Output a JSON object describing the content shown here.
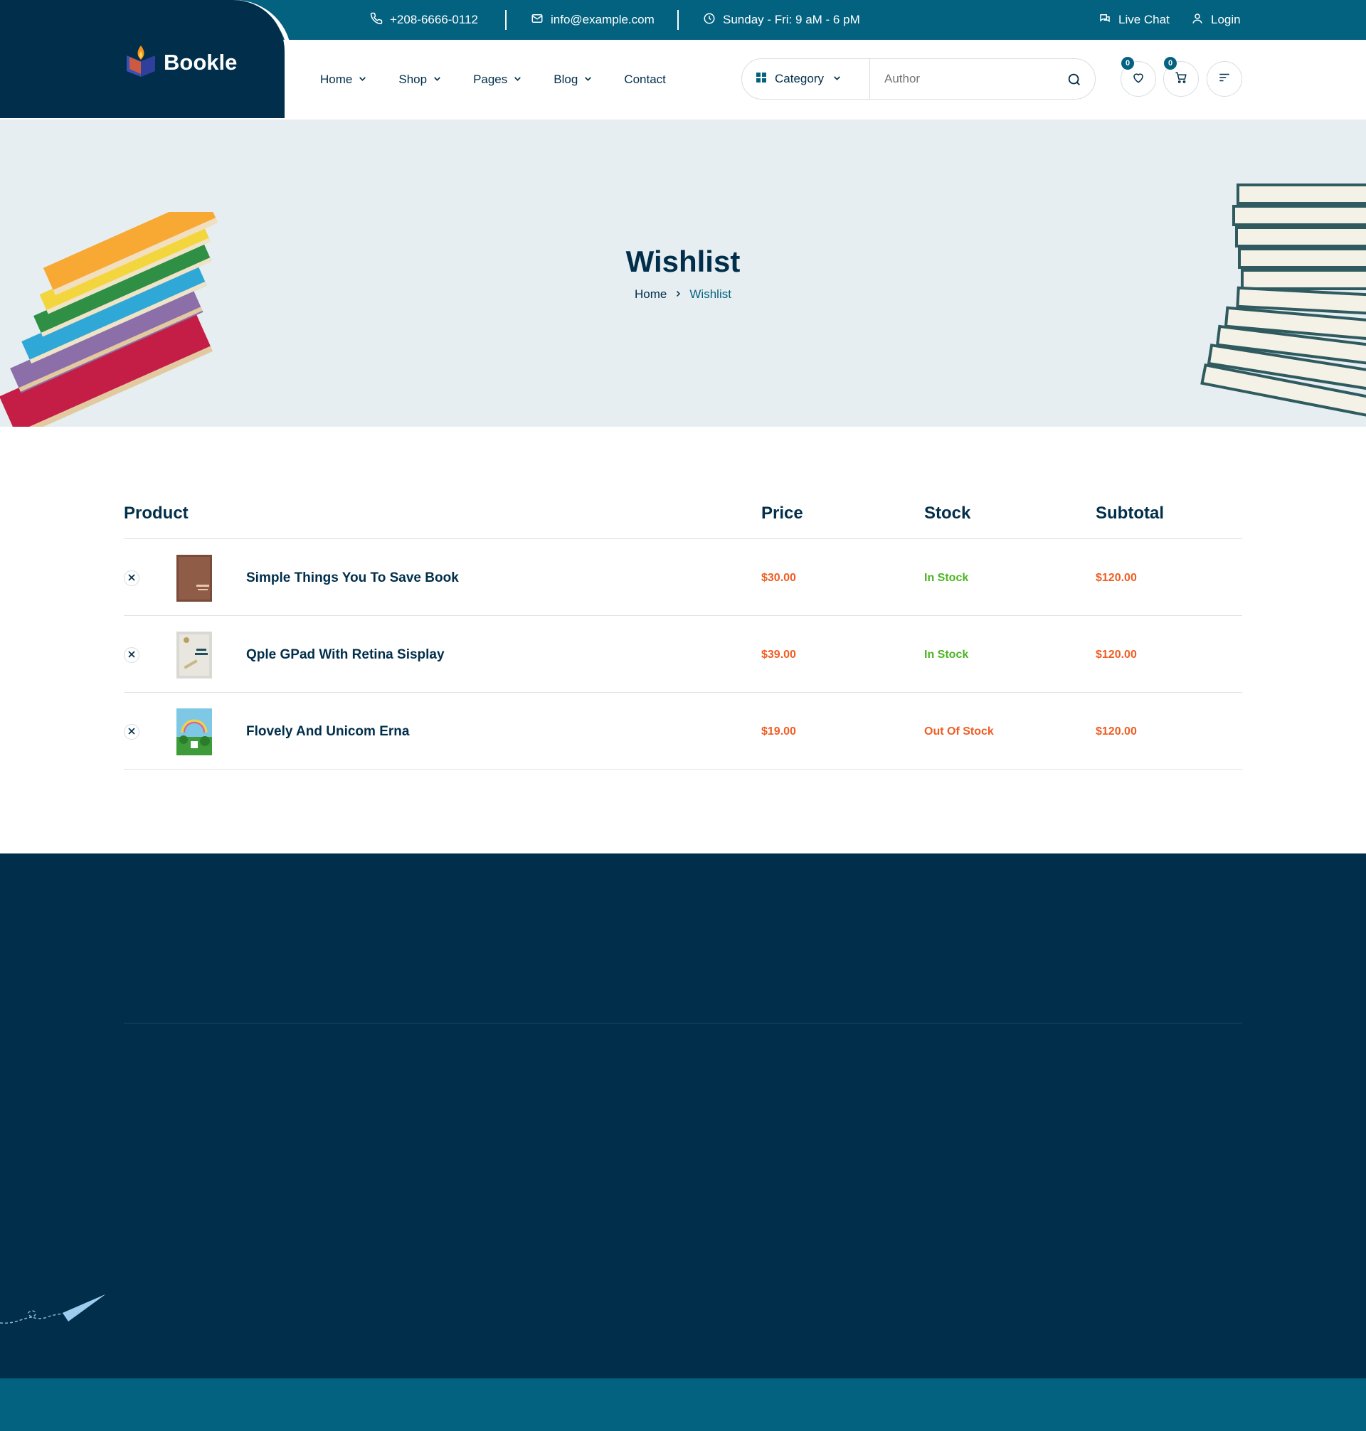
{
  "topbar": {
    "phone": "+208-6666-0112",
    "email": "info@example.com",
    "hours": "Sunday - Fri: 9 aM - 6 pM",
    "live_chat": "Live Chat",
    "login": "Login"
  },
  "brand": {
    "name": "Bookle"
  },
  "nav": {
    "home": "Home",
    "shop": "Shop",
    "pages": "Pages",
    "blog": "Blog",
    "contact": "Contact"
  },
  "search": {
    "category_label": "Category",
    "placeholder": "Author"
  },
  "header_actions": {
    "wishlist_count": "0",
    "cart_count": "0"
  },
  "hero": {
    "title": "Wishlist",
    "breadcrumb_home": "Home",
    "breadcrumb_current": "Wishlist"
  },
  "table": {
    "headers": {
      "product": "Product",
      "price": "Price",
      "stock": "Stock",
      "subtotal": "Subtotal"
    },
    "rows": [
      {
        "name": "Simple Things You To Save Book",
        "price": "$30.00",
        "stock": "In Stock",
        "subtotal": "$120.00"
      },
      {
        "name": "Qple GPad With Retina Sisplay",
        "price": "$39.00",
        "stock": "In Stock",
        "subtotal": "$120.00"
      },
      {
        "name": "Flovely And Unicom Erna",
        "price": "$19.00",
        "stock": "Out Of Stock",
        "subtotal": "$120.00"
      }
    ]
  },
  "colors": {
    "navy": "#012e4a",
    "teal": "#036280",
    "hero_bg": "#e6eef1",
    "price_orange": "#f05d23",
    "in_stock_green": "#4cb521"
  }
}
